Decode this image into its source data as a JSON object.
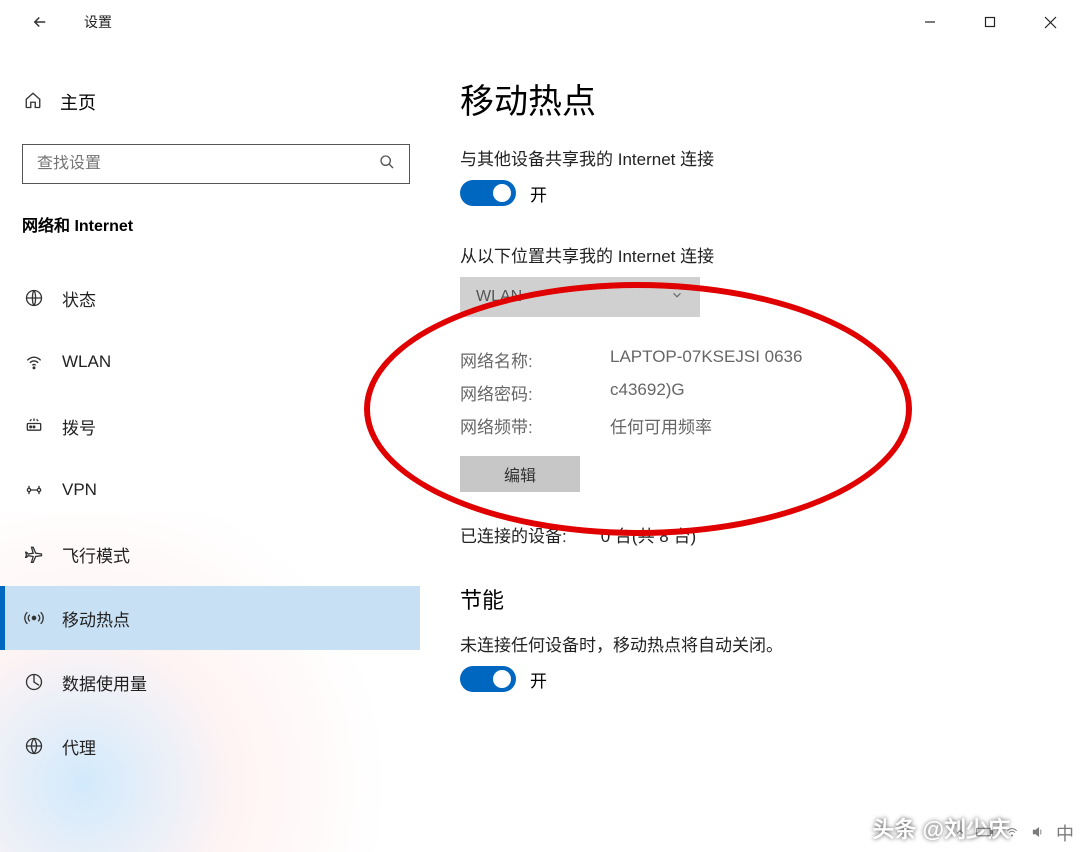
{
  "titlebar": {
    "app_title": "设置"
  },
  "sidebar": {
    "home": "主页",
    "search_placeholder": "查找设置",
    "category": "网络和 Internet",
    "items": [
      {
        "label": "状态",
        "icon": "status"
      },
      {
        "label": "WLAN",
        "icon": "wlan"
      },
      {
        "label": "拨号",
        "icon": "dialup"
      },
      {
        "label": "VPN",
        "icon": "vpn"
      },
      {
        "label": "飞行模式",
        "icon": "airplane"
      },
      {
        "label": "移动热点",
        "icon": "hotspot",
        "active": true
      },
      {
        "label": "数据使用量",
        "icon": "datausage"
      },
      {
        "label": "代理",
        "icon": "proxy"
      }
    ]
  },
  "main": {
    "title": "移动热点",
    "share_label": "与其他设备共享我的 Internet 连接",
    "share_toggle": "开",
    "from_label": "从以下位置共享我的 Internet 连接",
    "from_value": "WLAN",
    "info": {
      "name_label": "网络名称:",
      "name_value": "LAPTOP-07KSEJSI 0636",
      "pwd_label": "网络密码:",
      "pwd_value": "c43692)G",
      "band_label": "网络频带:",
      "band_value": "任何可用频率"
    },
    "edit_btn": "编辑",
    "connected_label": "已连接的设备:",
    "connected_value": "0 台(共 8 台)",
    "powersave_title": "节能",
    "powersave_desc": "未连接任何设备时，移动热点将自动关闭。",
    "powersave_toggle": "开"
  },
  "watermark": "头条 @刘少庆",
  "tray_ime": "中"
}
